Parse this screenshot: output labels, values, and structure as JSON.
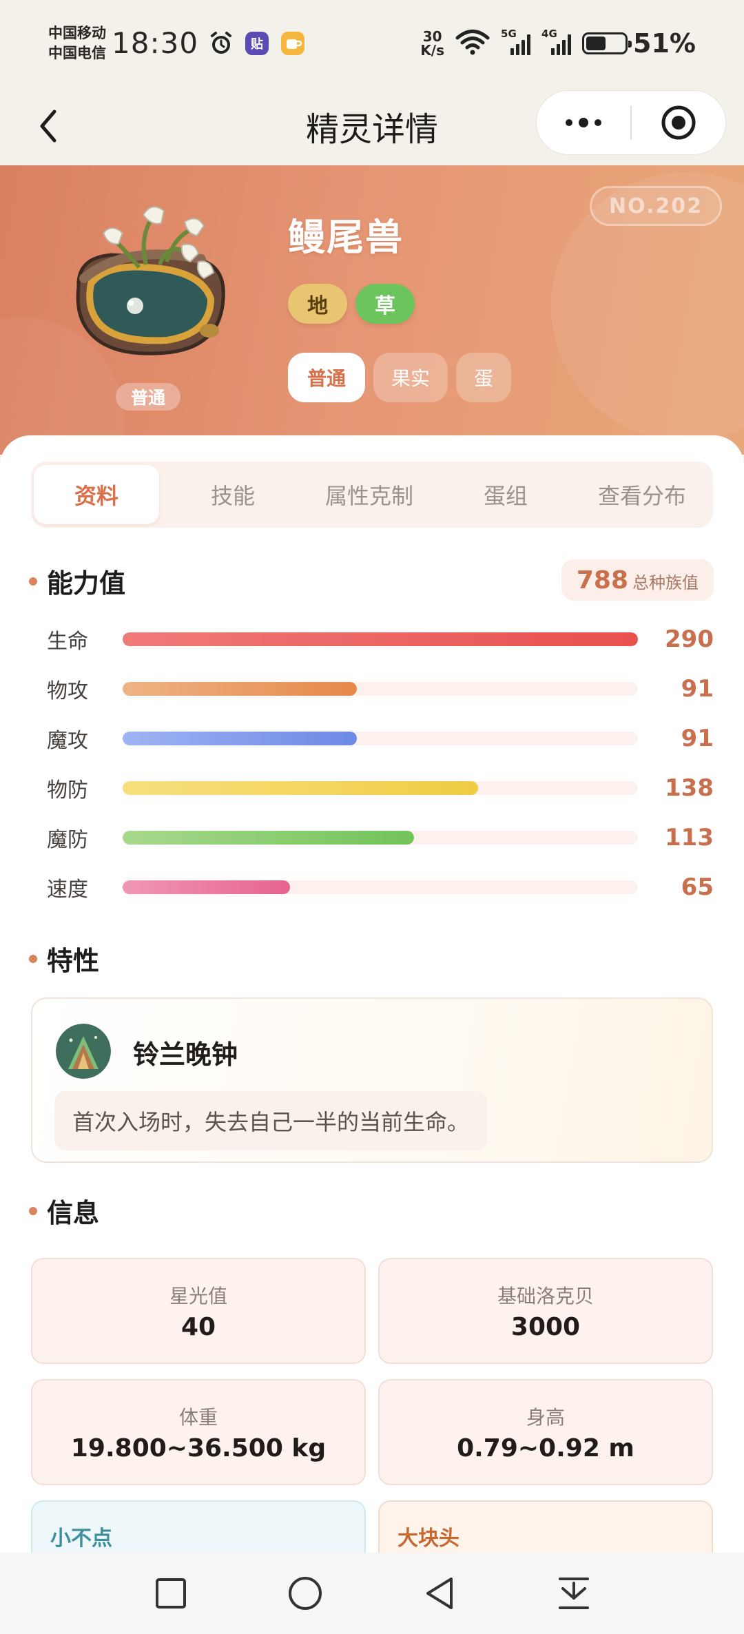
{
  "status_bar": {
    "carrier_1": "中国移动",
    "carrier_2": "中国电信",
    "time": "18:30",
    "net_speed_value": "30",
    "net_speed_unit": "K/s",
    "signal_1_label": "5G",
    "signal_2_label": "4G",
    "battery_percent": "51%",
    "battery_level": 0.51
  },
  "title_bar": {
    "title": "精灵详情",
    "icons": [
      "back-arrow-icon",
      "more-dots-icon",
      "target-close-icon"
    ]
  },
  "hero": {
    "dex_no": "NO.202",
    "name": "鳗尾兽",
    "form_badge": "普通",
    "types": [
      {
        "label": "地",
        "color": "#e8c671"
      },
      {
        "label": "草",
        "color": "#6cc45d"
      }
    ],
    "forms": [
      {
        "label": "普通",
        "active": true
      },
      {
        "label": "果实",
        "active": false
      },
      {
        "label": "蛋",
        "active": false
      }
    ],
    "bg_color": "#e59573"
  },
  "tabs": [
    {
      "label": "资料",
      "active": true
    },
    {
      "label": "技能",
      "active": false
    },
    {
      "label": "属性克制",
      "active": false
    },
    {
      "label": "蛋组",
      "active": false
    },
    {
      "label": "查看分布",
      "active": false
    }
  ],
  "stats": {
    "section_title": "能力值",
    "total_value": "788",
    "total_label": "总种族值",
    "items": [
      {
        "name": "生命",
        "value": "290",
        "fraction": 1.0,
        "color_from": "#f07a78",
        "color_to": "#e8504e"
      },
      {
        "name": "物攻",
        "value": "91",
        "fraction": 0.455,
        "color_from": "#efb384",
        "color_to": "#e6884a"
      },
      {
        "name": "魔攻",
        "value": "91",
        "fraction": 0.455,
        "color_from": "#9fb4f3",
        "color_to": "#6c89e6"
      },
      {
        "name": "物防",
        "value": "138",
        "fraction": 0.69,
        "color_from": "#f8e07f",
        "color_to": "#f0cc44"
      },
      {
        "name": "魔防",
        "value": "113",
        "fraction": 0.565,
        "color_from": "#a7d98c",
        "color_to": "#72c35a"
      },
      {
        "name": "速度",
        "value": "65",
        "fraction": 0.325,
        "color_from": "#f197b4",
        "color_to": "#e6648f"
      }
    ]
  },
  "trait": {
    "section_title": "特性",
    "name": "铃兰晚钟",
    "description": "首次入场时，失去自己一半的当前生命。",
    "icon": "lily-bell-trait-icon"
  },
  "info": {
    "section_title": "信息",
    "cards": [
      {
        "label": "星光值",
        "value": "40"
      },
      {
        "label": "基础洛克贝",
        "value": "3000"
      },
      {
        "label": "体重",
        "value": "19.800~36.500 kg"
      },
      {
        "label": "身高",
        "value": "0.79~0.92 m"
      }
    ],
    "size_small": "小不点",
    "size_big": "大块头"
  },
  "nav_bar": {
    "icons": [
      "recents-square-icon",
      "home-circle-icon",
      "back-triangle-icon",
      "notification-pull-icon"
    ]
  }
}
